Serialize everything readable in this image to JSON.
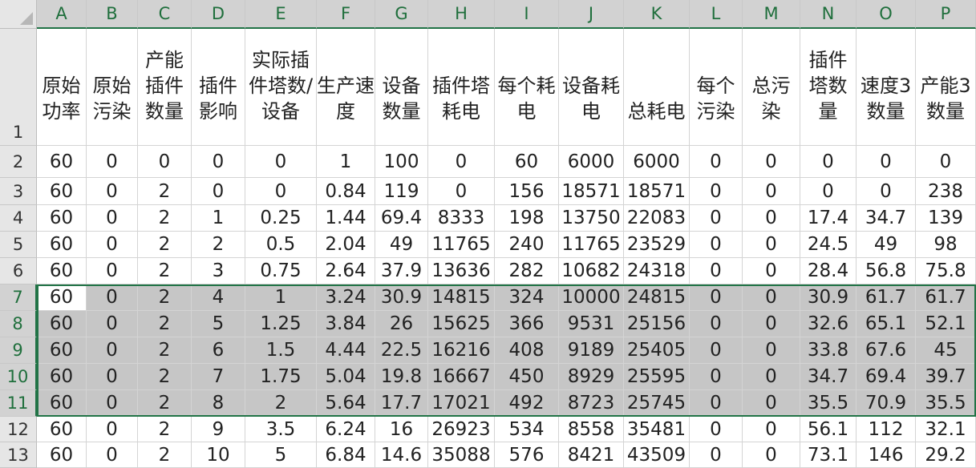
{
  "columns": [
    "A",
    "B",
    "C",
    "D",
    "E",
    "F",
    "G",
    "H",
    "I",
    "J",
    "K",
    "L",
    "M",
    "N",
    "O",
    "P"
  ],
  "header_row": {
    "row_number": "1",
    "labels": [
      "原始功率",
      "原始污染",
      "产能插件数量",
      "插件影响",
      "实际插件塔数/设备",
      "生产速度",
      "设备数量",
      "插件塔耗电",
      "每个耗电",
      "设备耗电",
      "总耗电",
      "每个污染",
      "总污染",
      "插件塔数量",
      "速度3数量",
      "产能3数量"
    ]
  },
  "rows": [
    {
      "num": "2",
      "cells": [
        "60",
        "0",
        "0",
        "0",
        "0",
        "1",
        "100",
        "0",
        "60",
        "6000",
        "6000",
        "0",
        "0",
        "0",
        "0",
        "0"
      ]
    },
    {
      "num": "3",
      "cells": [
        "60",
        "0",
        "2",
        "0",
        "0",
        "0.84",
        "119",
        "0",
        "156",
        "18571",
        "18571",
        "0",
        "0",
        "0",
        "0",
        "238"
      ]
    },
    {
      "num": "4",
      "cells": [
        "60",
        "0",
        "2",
        "1",
        "0.25",
        "1.44",
        "69.4",
        "8333",
        "198",
        "13750",
        "22083",
        "0",
        "0",
        "17.4",
        "34.7",
        "139"
      ]
    },
    {
      "num": "5",
      "cells": [
        "60",
        "0",
        "2",
        "2",
        "0.5",
        "2.04",
        "49",
        "11765",
        "240",
        "11765",
        "23529",
        "0",
        "0",
        "24.5",
        "49",
        "98"
      ]
    },
    {
      "num": "6",
      "cells": [
        "60",
        "0",
        "2",
        "3",
        "0.75",
        "2.64",
        "37.9",
        "13636",
        "282",
        "10682",
        "24318",
        "0",
        "0",
        "28.4",
        "56.8",
        "75.8"
      ]
    },
    {
      "num": "7",
      "cells": [
        "60",
        "0",
        "2",
        "4",
        "1",
        "3.24",
        "30.9",
        "14815",
        "324",
        "10000",
        "24815",
        "0",
        "0",
        "30.9",
        "61.7",
        "61.7"
      ]
    },
    {
      "num": "8",
      "cells": [
        "60",
        "0",
        "2",
        "5",
        "1.25",
        "3.84",
        "26",
        "15625",
        "366",
        "9531",
        "25156",
        "0",
        "0",
        "32.6",
        "65.1",
        "52.1"
      ]
    },
    {
      "num": "9",
      "cells": [
        "60",
        "0",
        "2",
        "6",
        "1.5",
        "4.44",
        "22.5",
        "16216",
        "408",
        "9189",
        "25405",
        "0",
        "0",
        "33.8",
        "67.6",
        "45"
      ]
    },
    {
      "num": "10",
      "cells": [
        "60",
        "0",
        "2",
        "7",
        "1.75",
        "5.04",
        "19.8",
        "16667",
        "450",
        "8929",
        "25595",
        "0",
        "0",
        "34.7",
        "69.4",
        "39.7"
      ]
    },
    {
      "num": "11",
      "cells": [
        "60",
        "0",
        "2",
        "8",
        "2",
        "5.64",
        "17.7",
        "17021",
        "492",
        "8723",
        "25745",
        "0",
        "0",
        "35.5",
        "70.9",
        "35.5"
      ]
    },
    {
      "num": "12",
      "cells": [
        "60",
        "0",
        "2",
        "9",
        "3.5",
        "6.24",
        "16",
        "26923",
        "534",
        "8558",
        "35481",
        "0",
        "0",
        "56.1",
        "112",
        "32.1"
      ]
    },
    {
      "num": "13",
      "cells": [
        "60",
        "0",
        "2",
        "10",
        "5",
        "6.84",
        "14.6",
        "35088",
        "576",
        "8421",
        "43509",
        "0",
        "0",
        "73.1",
        "146",
        "29.2"
      ]
    }
  ],
  "selection": {
    "first_row": "7",
    "last_row": "11",
    "active_cell": "A7"
  },
  "colors": {
    "selection_border": "#217346",
    "selection_fill": "#c6c6c6",
    "header_fill": "#e6e6e6"
  }
}
